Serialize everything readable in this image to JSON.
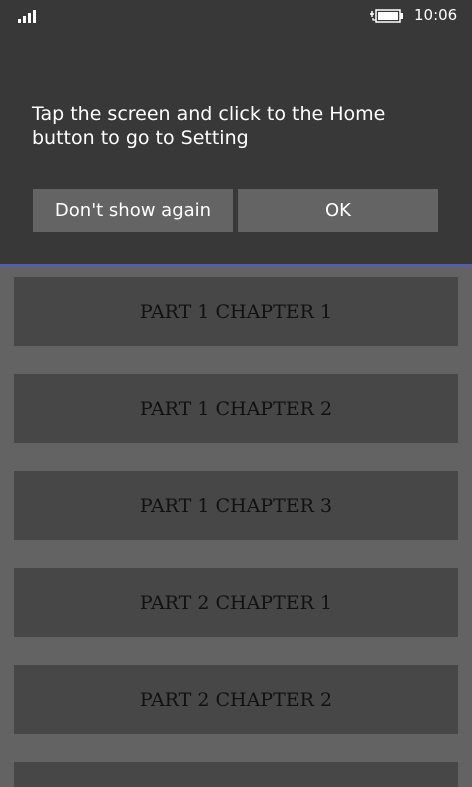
{
  "status_bar": {
    "time": "10:06",
    "signal_icon": "signal-bars-icon",
    "battery_icon": "battery-charging-icon"
  },
  "dialog": {
    "message": "Tap the screen and click to the Home button to go to Setting",
    "dont_show_label": "Don't show again",
    "ok_label": "OK"
  },
  "chapters": [
    "PART 1 CHAPTER 1",
    "PART 1 CHAPTER 2",
    "PART 1 CHAPTER 3",
    "PART 2 CHAPTER 1",
    "PART 2 CHAPTER 2"
  ],
  "colors": {
    "dialog_bg": "#383838",
    "accent_line": "#4a5fc6",
    "button_bg": "#646464",
    "list_bg": "#636363",
    "item_bg": "#474747"
  }
}
